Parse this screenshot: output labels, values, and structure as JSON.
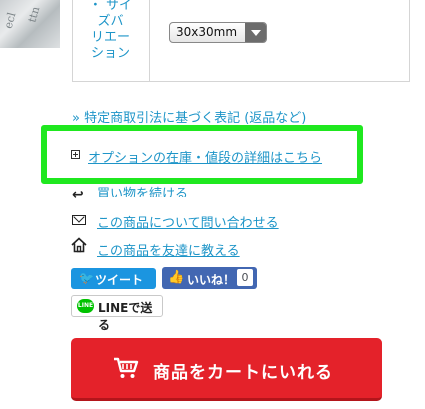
{
  "variation": {
    "label": "・サイズバリエーション",
    "label_lines": [
      "・ サイ",
      "ズバ",
      "リエー",
      "ション"
    ],
    "select_value": "30x30mm"
  },
  "links": {
    "tokushoho": "» 特定商取引法に基づく表記 (返品など)",
    "options_detail": "オプションの在庫・値段の詳細はこちら",
    "continue_shopping": "買い物を続ける",
    "inquiry": "この商品について問い合わせる",
    "tell_friend": "この商品を友達に教える"
  },
  "social": {
    "tweet_label": "ツイート",
    "like_label": "いいね！",
    "like_count": "0",
    "line_label": "LINEで送る",
    "line_badge": "LINE"
  },
  "cart": {
    "label": "商品をカートにいれる"
  },
  "colors": {
    "link": "#1e95c8",
    "highlight": "#1fe81f",
    "cart": "#e4222a",
    "twitter": "#1b95e0",
    "facebook": "#4267b2",
    "line": "#00c300"
  },
  "icons": {
    "plus": "plus-square-icon",
    "shopping": "shopping-arrow-icon",
    "mail": "mail-icon",
    "home": "home-icon",
    "twitter": "twitter-bird-icon",
    "facebook": "thumbs-up-icon",
    "line": "line-icon",
    "cart": "cart-icon"
  }
}
